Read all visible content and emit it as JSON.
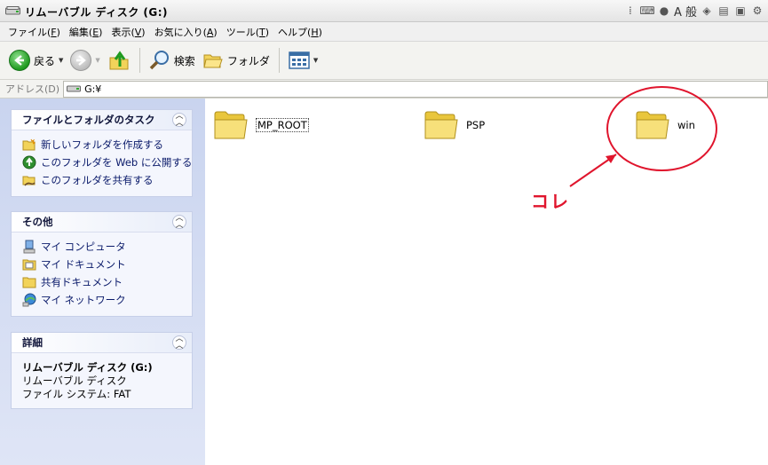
{
  "window": {
    "title": "リムーバブル ディスク (G:)",
    "tray_text": "A 般"
  },
  "menu": [
    {
      "label": "ファイル(",
      "key": "F",
      "end": ")"
    },
    {
      "label": "編集(",
      "key": "E",
      "end": ")"
    },
    {
      "label": "表示(",
      "key": "V",
      "end": ")"
    },
    {
      "label": "お気に入り(",
      "key": "A",
      "end": ")"
    },
    {
      "label": "ツール(",
      "key": "T",
      "end": ")"
    },
    {
      "label": "ヘルプ(",
      "key": "H",
      "end": ")"
    }
  ],
  "toolbar": {
    "back_label": "戻る",
    "search_label": "検索",
    "folders_label": "フォルダ"
  },
  "address": {
    "label": "アドレス(D)",
    "value": "G:¥"
  },
  "left": {
    "tasks": {
      "title": "ファイルとフォルダのタスク",
      "items": [
        "新しいフォルダを作成する",
        "このフォルダを Web に公開する",
        "このフォルダを共有する"
      ]
    },
    "other": {
      "title": "その他",
      "items": [
        "マイ コンピュータ",
        "マイ ドキュメント",
        "共有ドキュメント",
        "マイ ネットワーク"
      ]
    },
    "details": {
      "title": "詳細",
      "name": "リムーバブル ディスク (G:)",
      "type": "リムーバブル ディスク",
      "fs": "ファイル システム: FAT"
    }
  },
  "content": {
    "folders": [
      "MP_ROOT",
      "PSP",
      "win"
    ],
    "annotation": "コレ",
    "annotation_color": "#e0152d"
  }
}
